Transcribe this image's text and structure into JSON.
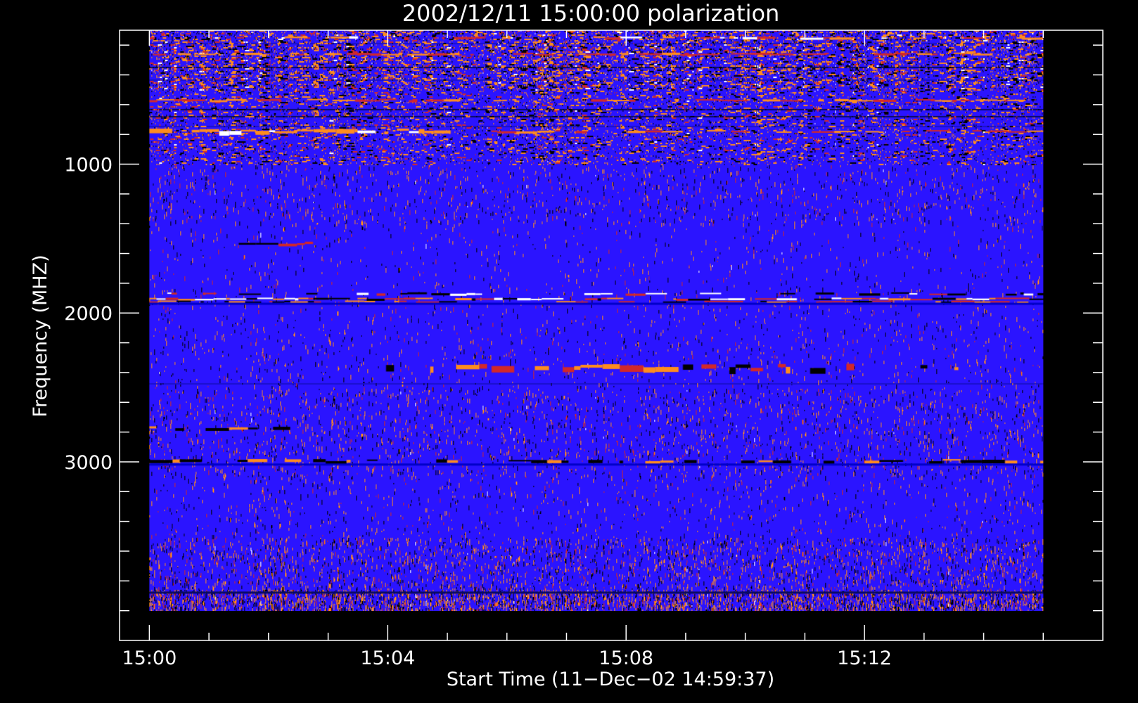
{
  "chart_data": {
    "type": "heatmap",
    "title": "2002/12/11 15:00:00 polarization",
    "xlabel": "Start Time (11−Dec−02 14:59:37)",
    "ylabel": "Frequency (MHZ)",
    "x_ticks": [
      "15:00",
      "15:04",
      "15:08",
      "15:12"
    ],
    "x_tick_minutes": [
      0,
      4,
      8,
      12
    ],
    "xlim_minutes": [
      -0.5,
      16
    ],
    "y_ticks": [
      1000,
      2000,
      3000
    ],
    "ylim": [
      100,
      4200
    ],
    "y_reversed": true,
    "data_range": {
      "time_minutes": [
        0,
        15
      ],
      "frequency_mhz": [
        100,
        4000
      ]
    },
    "colormap": [
      "#000000",
      "#2b14ff",
      "#d2282a",
      "#ff8c1e",
      "#ffffff"
    ],
    "background_color": "#2b14ff",
    "features": [
      {
        "frequency_mhz": [
          100,
          500
        ],
        "intensity": "dense speckle"
      },
      {
        "frequency_mhz": [
          760,
          800
        ],
        "intensity": "strong band 15:00–15:05"
      },
      {
        "frequency_mhz": [
          1880,
          1920
        ],
        "intensity": "strongest band, bright white segments"
      },
      {
        "frequency_mhz": [
          2340,
          2400
        ],
        "intensity": "orange/red band from 15:04"
      },
      {
        "frequency_mhz": [
          3500,
          4000
        ],
        "intensity": "dense orange speckle at low edge"
      }
    ]
  }
}
